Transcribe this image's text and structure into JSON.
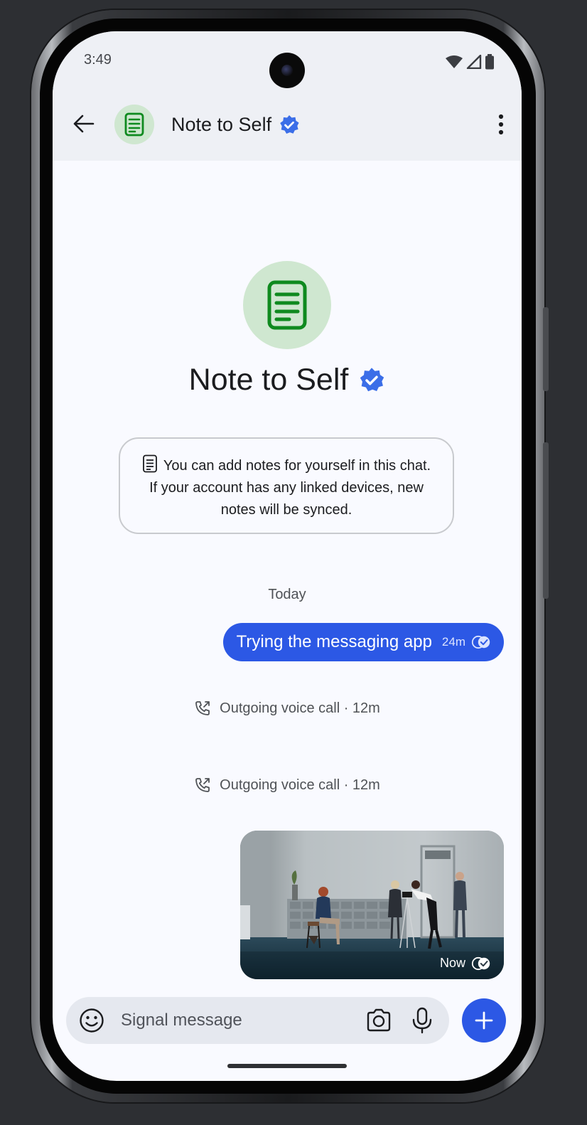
{
  "status_bar": {
    "time": "3:49"
  },
  "app_bar": {
    "title": "Note to Self",
    "back_icon": "arrow-left-icon",
    "menu_icon": "more-vertical-icon"
  },
  "profile": {
    "name": "Note to Self",
    "verified": true,
    "description": "You can add notes for yourself in this chat. If your account has any linked devices, new notes will be synced."
  },
  "conversation": {
    "date_label": "Today",
    "messages": [
      {
        "type": "text",
        "direction": "outgoing",
        "text": "Trying the messaging app",
        "time": "24m",
        "status": "delivered"
      },
      {
        "type": "call",
        "text": "Outgoing voice call · 12m"
      },
      {
        "type": "call",
        "text": "Outgoing voice call · 12m"
      },
      {
        "type": "image",
        "direction": "outgoing",
        "time": "Now",
        "status": "delivered"
      }
    ]
  },
  "composer": {
    "placeholder": "Signal message",
    "emoji_icon": "emoji-icon",
    "camera_icon": "camera-icon",
    "mic_icon": "microphone-icon",
    "add_icon": "plus-icon"
  },
  "colors": {
    "accent": "#2c58e5",
    "avatar_bg": "#cfe7d0",
    "avatar_fg": "#0f8a1f",
    "verified": "#3b6ee8"
  }
}
